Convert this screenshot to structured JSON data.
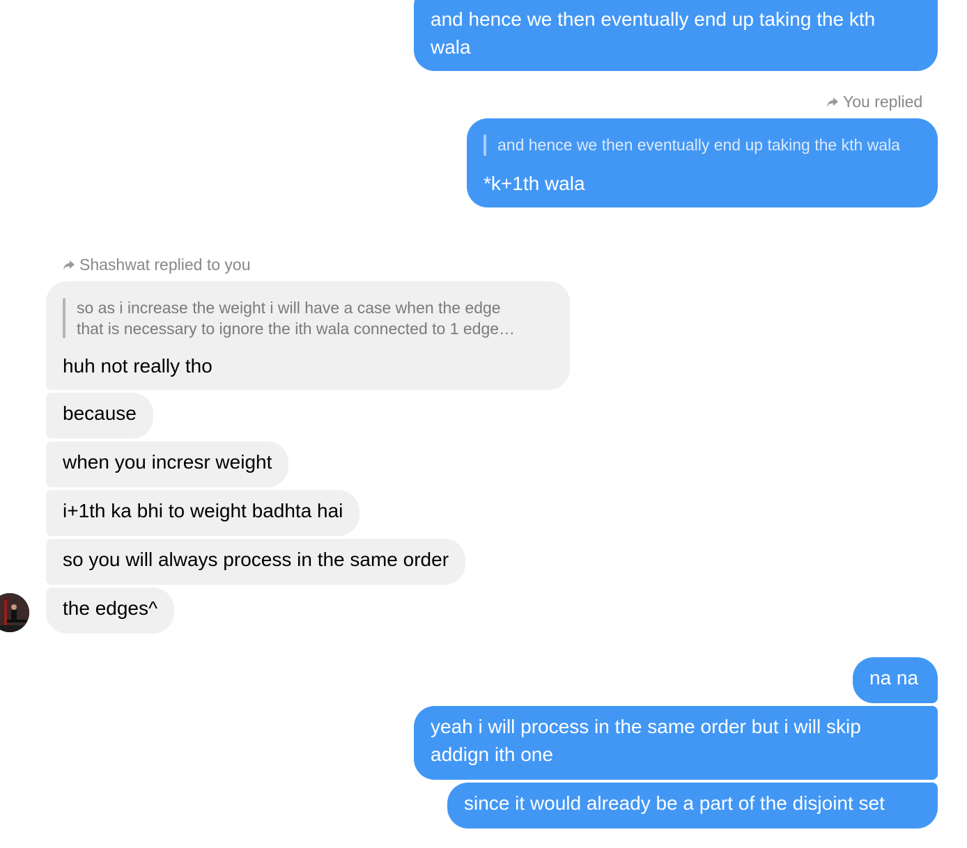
{
  "messages": {
    "m1": "and hence we then eventually end up taking the kth wala",
    "you_replied_label": "You replied",
    "reply1_quote": "and hence we then eventually end up taking the kth wala",
    "reply1_text": "*k+1th wala",
    "shashwat_replied_label": "Shashwat replied to you",
    "reply2_quote_line1": "so as i increase the weight i will have a case when the edge",
    "reply2_quote_line2": "that is necessary to ignore the ith wala connected to 1 edge…",
    "reply2_text": "huh not really tho",
    "in2": "because",
    "in3": "when you incresr weight",
    "in4": "i+1th ka bhi to weight badhta hai",
    "in5": "so you will always process in the same order",
    "in6": "the edges^",
    "out2": "na na",
    "out3": "yeah i will process in the same order but i will skip addign ith one",
    "out4": "since it would already be a part of the disjoint set"
  },
  "colors": {
    "outgoing_bubble": "#4297f5",
    "incoming_bubble": "#f0f0f0",
    "meta_text": "#888888"
  },
  "icons": {
    "reply": "reply-arrow-icon",
    "avatar": "contact-avatar"
  }
}
